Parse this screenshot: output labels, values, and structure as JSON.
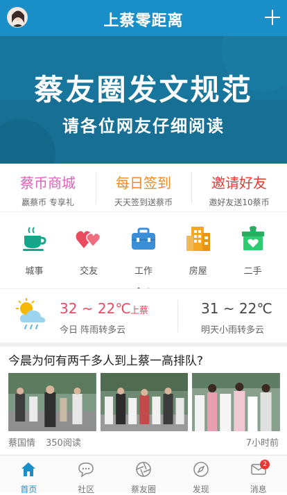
{
  "header": {
    "title": "上蔡零距离",
    "add_icon": "plus-icon",
    "avatar_icon": "user-avatar"
  },
  "banner": {
    "title": "蔡友圈发文规范",
    "subtitle": "请各位网友仔细阅读"
  },
  "promos": [
    {
      "title": "蔡币商城",
      "subtitle": "赢蔡币 专享礼",
      "color": "#e05fb8"
    },
    {
      "title": "每日签到",
      "subtitle": "天天签到送蔡币",
      "color": "#f08a24"
    },
    {
      "title": "邀请好友",
      "subtitle": "邀好友送10蔡币",
      "color": "#e53935"
    }
  ],
  "categories": [
    {
      "label": "城事",
      "icon": "coffee-cup-icon",
      "color": "#17a589"
    },
    {
      "label": "交友",
      "icon": "hearts-icon",
      "color": "#e84a5f"
    },
    {
      "label": "工作",
      "icon": "briefcase-icon",
      "color": "#3b8ed8"
    },
    {
      "label": "房屋",
      "icon": "buildings-icon",
      "color": "#f5a623"
    },
    {
      "label": "二手",
      "icon": "box-heart-icon",
      "color": "#27ae60"
    }
  ],
  "weather": {
    "today_temp": "32 ~ 22℃",
    "city": "上蔡",
    "today_desc": "今日 阵雨转多云",
    "tomorrow_temp": "31 ~ 22℃",
    "tomorrow_desc": "明天小雨转多云",
    "icon": "sun-rain-icon"
  },
  "article": {
    "title": "今晨为何有两千多人到上蔡一高排队?",
    "source": "蔡国情",
    "reads": "350阅读",
    "time": "7小时前"
  },
  "tabs": [
    {
      "label": "首页",
      "icon": "home-icon",
      "active": true
    },
    {
      "label": "社区",
      "icon": "chat-bubble-icon",
      "active": false
    },
    {
      "label": "蔡友圈",
      "icon": "aperture-icon",
      "active": false
    },
    {
      "label": "发现",
      "icon": "compass-icon",
      "active": false
    },
    {
      "label": "消息",
      "icon": "mail-icon",
      "active": false,
      "badge": "2"
    }
  ],
  "colors": {
    "brand": "#1a8fc7",
    "banner_bg": "#176f93",
    "active_tab": "#1a8fc7"
  }
}
